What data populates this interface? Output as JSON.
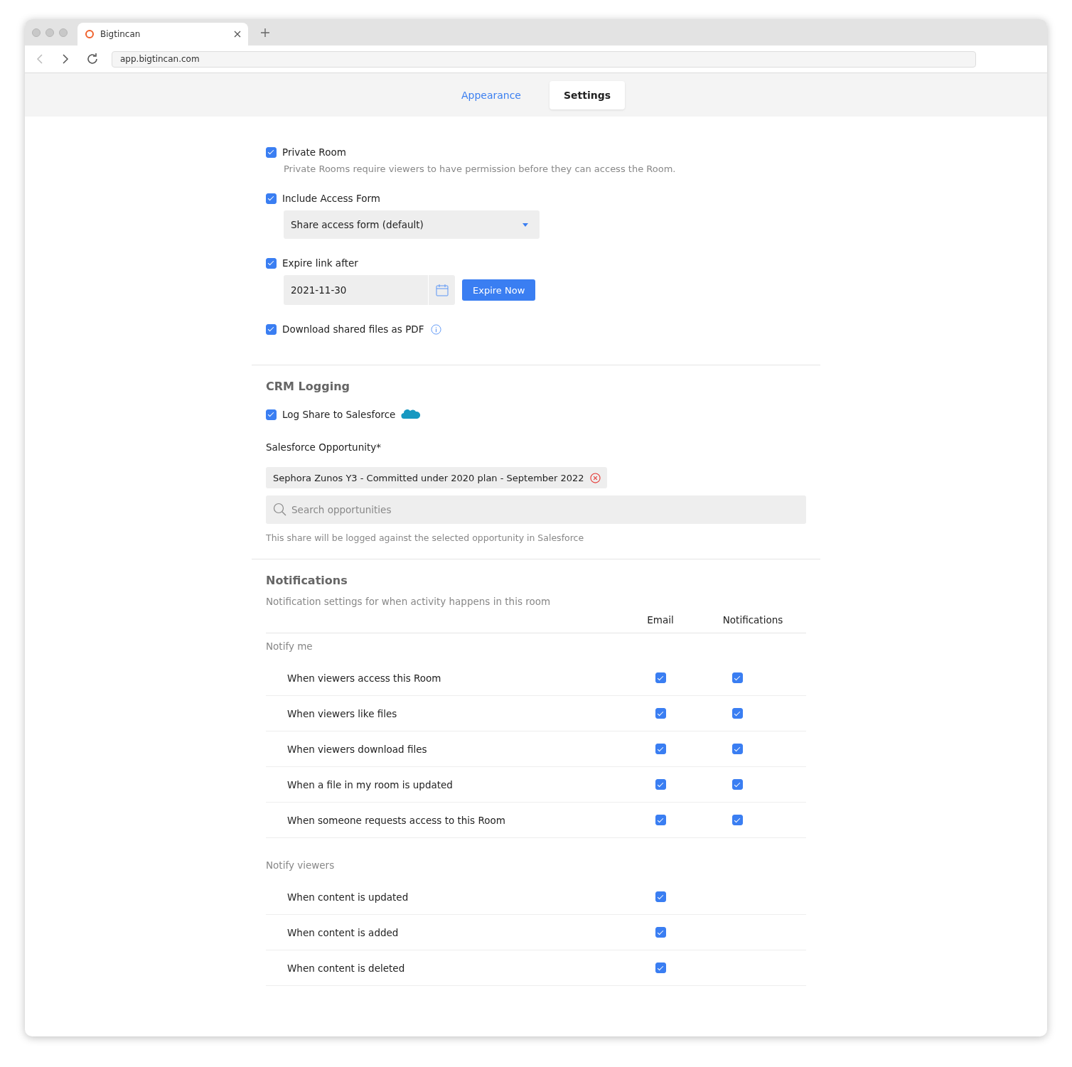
{
  "browser": {
    "tab_title": "Bigtincan",
    "url": "app.bigtincan.com"
  },
  "tabs": [
    {
      "label": "Appearance",
      "selected": false
    },
    {
      "label": "Settings",
      "selected": true
    }
  ],
  "options": [
    {
      "kind": "plain",
      "label": "Private Room",
      "checked": true,
      "description": "Private Rooms require viewers to have permission before they can access the Room."
    },
    {
      "kind": "select",
      "label": "Include Access Form",
      "checked": true,
      "value": "Share access form (default)"
    },
    {
      "kind": "date",
      "label": "Expire link after",
      "checked": true,
      "value": "2021-11-30",
      "button": "Expire Now"
    },
    {
      "kind": "info",
      "label": "Download shared files as PDF",
      "checked": true
    }
  ],
  "crm": {
    "title": "CRM Logging",
    "checkbox": {
      "label": "Log Share to Salesforce",
      "checked": true
    },
    "field_label": "Salesforce Opportunity*",
    "chip": "Sephora Zunos Y3 - Committed under 2020 plan - September 2022",
    "search_placeholder": "Search opportunities",
    "hint": "This share will be logged against the selected opportunity in Salesforce"
  },
  "notifications": {
    "title": "Notifications",
    "subtitle": "Notification settings for when activity happens in this room",
    "columns": [
      "Email",
      "Notifications"
    ],
    "groups": [
      {
        "title": "Notify me",
        "rows": [
          {
            "label": "When viewers access this Room",
            "email": true,
            "notifications": true
          },
          {
            "label": "When viewers like files",
            "email": true,
            "notifications": true
          },
          {
            "label": "When viewers download files",
            "email": true,
            "notifications": true
          },
          {
            "label": "When a file in my room is updated",
            "email": true,
            "notifications": true
          },
          {
            "label": "When someone requests access to this Room",
            "email": true,
            "notifications": true
          }
        ]
      },
      {
        "title": "Notify viewers",
        "rows": [
          {
            "label": "When content is updated",
            "email": true
          },
          {
            "label": "When content is added",
            "email": true
          },
          {
            "label": "When content is deleted",
            "email": true
          }
        ]
      }
    ]
  }
}
